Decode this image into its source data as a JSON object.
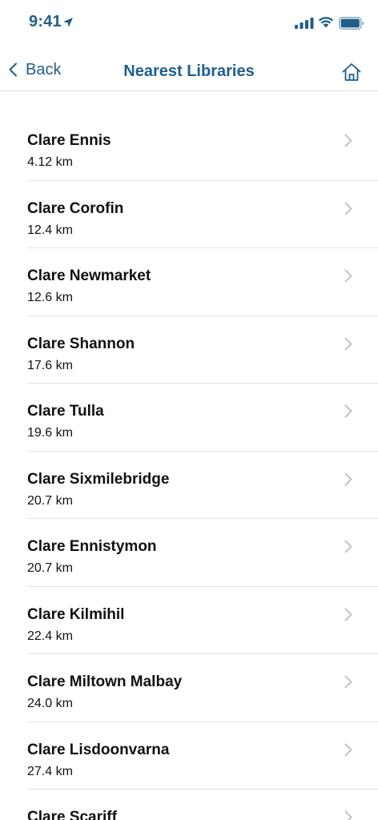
{
  "status_bar": {
    "time": "9:41"
  },
  "nav": {
    "back_label": "Back",
    "title": "Nearest Libraries"
  },
  "libraries": [
    {
      "name": "Clare Ennis",
      "distance": "4.12 km"
    },
    {
      "name": "Clare Corofin",
      "distance": "12.4 km"
    },
    {
      "name": "Clare Newmarket",
      "distance": "12.6 km"
    },
    {
      "name": "Clare Shannon",
      "distance": "17.6 km"
    },
    {
      "name": "Clare Tulla",
      "distance": "19.6 km"
    },
    {
      "name": "Clare Sixmilebridge",
      "distance": "20.7 km"
    },
    {
      "name": "Clare Ennistymon",
      "distance": "20.7 km"
    },
    {
      "name": "Clare Kilmihil",
      "distance": "22.4 km"
    },
    {
      "name": "Clare Miltown Malbay",
      "distance": "24.0 km"
    },
    {
      "name": "Clare Lisdoonvarna",
      "distance": "27.4 km"
    },
    {
      "name": "Clare Scariff",
      "distance": ""
    }
  ],
  "icons": {
    "location": "location-arrow-icon",
    "signal": "cellular-signal-icon",
    "wifi": "wifi-icon",
    "battery": "battery-icon",
    "back": "chevron-left-icon",
    "home": "home-icon",
    "row": "chevron-right-icon"
  },
  "colors": {
    "accent": "#1f5f8b",
    "text": "#111111",
    "separator": "#e4e4e4",
    "chevron": "#c4c4c7"
  }
}
